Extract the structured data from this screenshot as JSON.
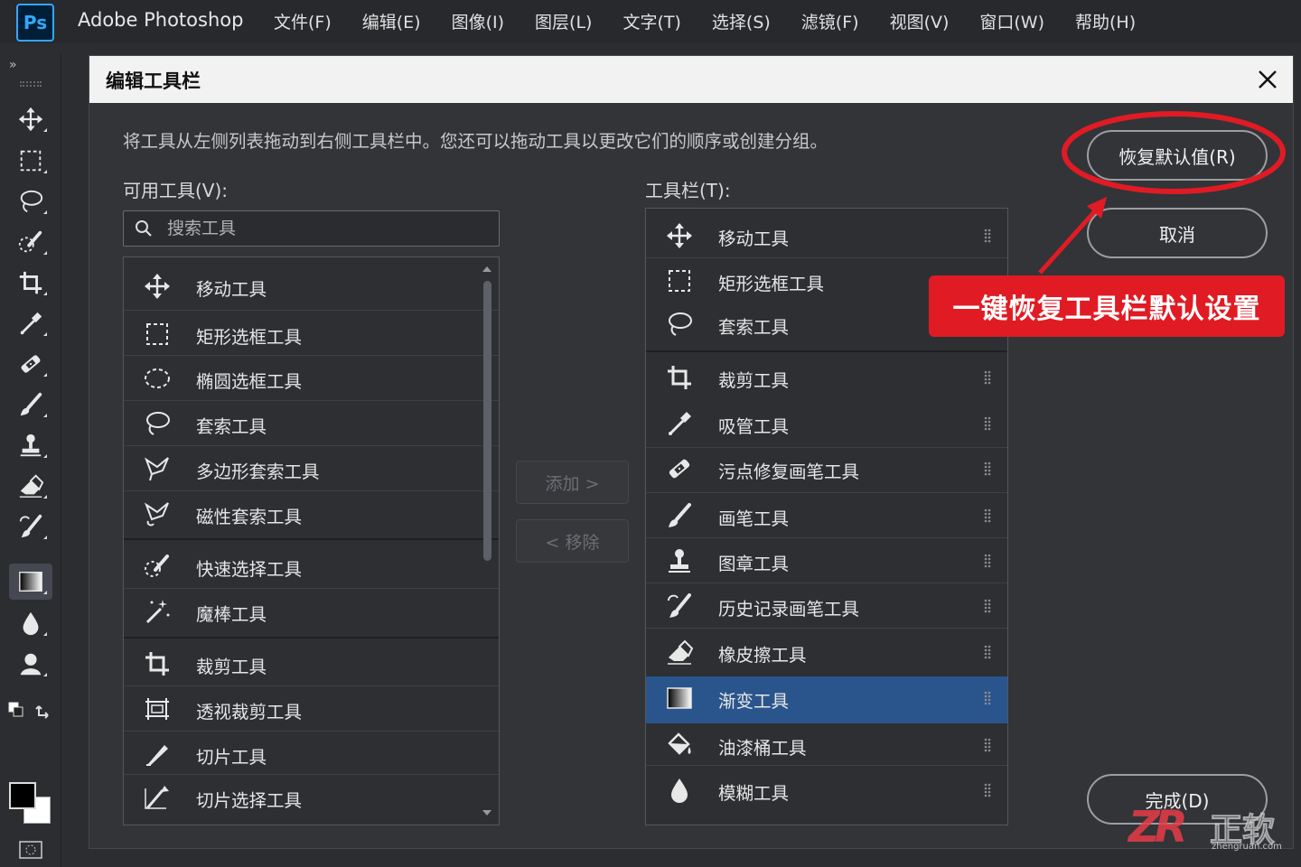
{
  "app": {
    "logo": "Ps",
    "name": "Adobe Photoshop"
  },
  "menu": [
    "文件(F)",
    "编辑(E)",
    "图像(I)",
    "图层(L)",
    "文字(T)",
    "选择(S)",
    "滤镜(F)",
    "视图(V)",
    "窗口(W)",
    "帮助(H)"
  ],
  "toolbar": {
    "collapse": "»",
    "tools": [
      "move-icon",
      "rect-marquee-icon",
      "lasso-icon",
      "quick-select-icon",
      "crop-icon",
      "eyedropper-icon",
      "healing-brush-icon",
      "brush-icon",
      "stamp-icon",
      "eraser-icon",
      "history-brush-icon",
      "gradient-icon",
      "blur-icon",
      "dodge-icon"
    ],
    "active_tool": "gradient-icon"
  },
  "dialog": {
    "title": "编辑工具栏",
    "description": "将工具从左侧列表拖动到右侧工具栏中。您还可以拖动工具以更改它们的顺序或创建分组。",
    "available_label": "可用工具(V):",
    "toolbar_label": "工具栏(T):",
    "search_placeholder": "搜索工具",
    "add_button": "添加 >",
    "remove_button": "< 移除",
    "restore_button": "恢复默认值(R)",
    "cancel_button": "取消",
    "done_button": "完成(D)",
    "available_tools": [
      {
        "label": "移动工具",
        "icon": "move-icon"
      },
      {
        "label": "矩形选框工具",
        "icon": "rect-marquee-icon"
      },
      {
        "label": "椭圆选框工具",
        "icon": "ellipse-marquee-icon"
      },
      {
        "label": "套索工具",
        "icon": "lasso-icon"
      },
      {
        "label": "多边形套索工具",
        "icon": "polygon-lasso-icon"
      },
      {
        "label": "磁性套索工具",
        "icon": "magnetic-lasso-icon"
      },
      {
        "label": "快速选择工具",
        "icon": "quick-select-icon"
      },
      {
        "label": "魔棒工具",
        "icon": "magic-wand-icon"
      },
      {
        "label": "裁剪工具",
        "icon": "crop-icon"
      },
      {
        "label": "透视裁剪工具",
        "icon": "perspective-crop-icon"
      },
      {
        "label": "切片工具",
        "icon": "slice-icon"
      },
      {
        "label": "切片选择工具",
        "icon": "slice-select-icon"
      }
    ],
    "toolbar_tools": [
      {
        "label": "移动工具",
        "icon": "move-icon"
      },
      {
        "label": "矩形选框工具",
        "icon": "rect-marquee-icon"
      },
      {
        "label": "套索工具",
        "icon": "lasso-icon"
      },
      {
        "label": "裁剪工具",
        "icon": "crop-icon"
      },
      {
        "label": "吸管工具",
        "icon": "eyedropper-icon"
      },
      {
        "label": "污点修复画笔工具",
        "icon": "healing-brush-icon"
      },
      {
        "label": "画笔工具",
        "icon": "brush-icon"
      },
      {
        "label": "图章工具",
        "icon": "stamp-icon"
      },
      {
        "label": "历史记录画笔工具",
        "icon": "history-brush-icon"
      },
      {
        "label": "橡皮擦工具",
        "icon": "eraser-icon"
      },
      {
        "label": "渐变工具",
        "icon": "gradient-icon",
        "selected": true
      },
      {
        "label": "油漆桶工具",
        "icon": "paint-bucket-icon"
      },
      {
        "label": "模糊工具",
        "icon": "blur-icon"
      }
    ]
  },
  "annotation": {
    "text": "一键恢复工具栏默认设置",
    "color": "#e01b24"
  },
  "watermark": {
    "logo": "ZR",
    "name": "正软",
    "url": "zhengruan.com"
  }
}
